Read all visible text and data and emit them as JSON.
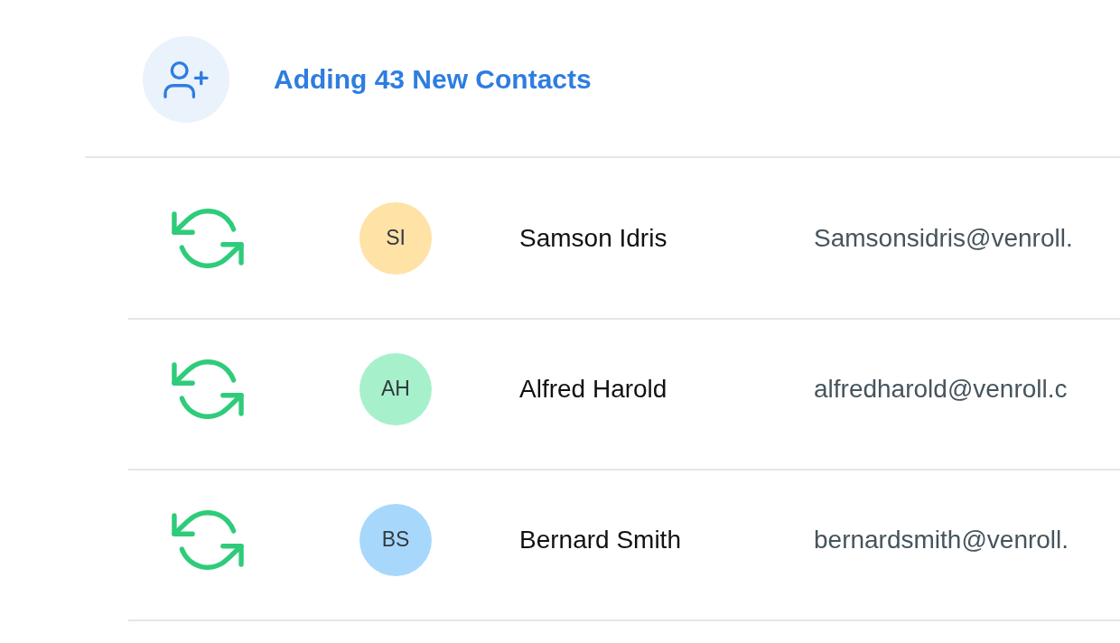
{
  "header": {
    "title": "Adding 43 New Contacts"
  },
  "contacts": [
    {
      "initials": "SI",
      "color": "#fee2a6",
      "name": "Samson Idris",
      "email": "Samsonsidris@venroll."
    },
    {
      "initials": "AH",
      "color": "#a7f0cc",
      "name": "Alfred Harold",
      "email": "alfredharold@venroll.c"
    },
    {
      "initials": "BS",
      "color": "#a7d8fc",
      "name": "Bernard Smith",
      "email": "bernardsmith@venroll."
    }
  ]
}
